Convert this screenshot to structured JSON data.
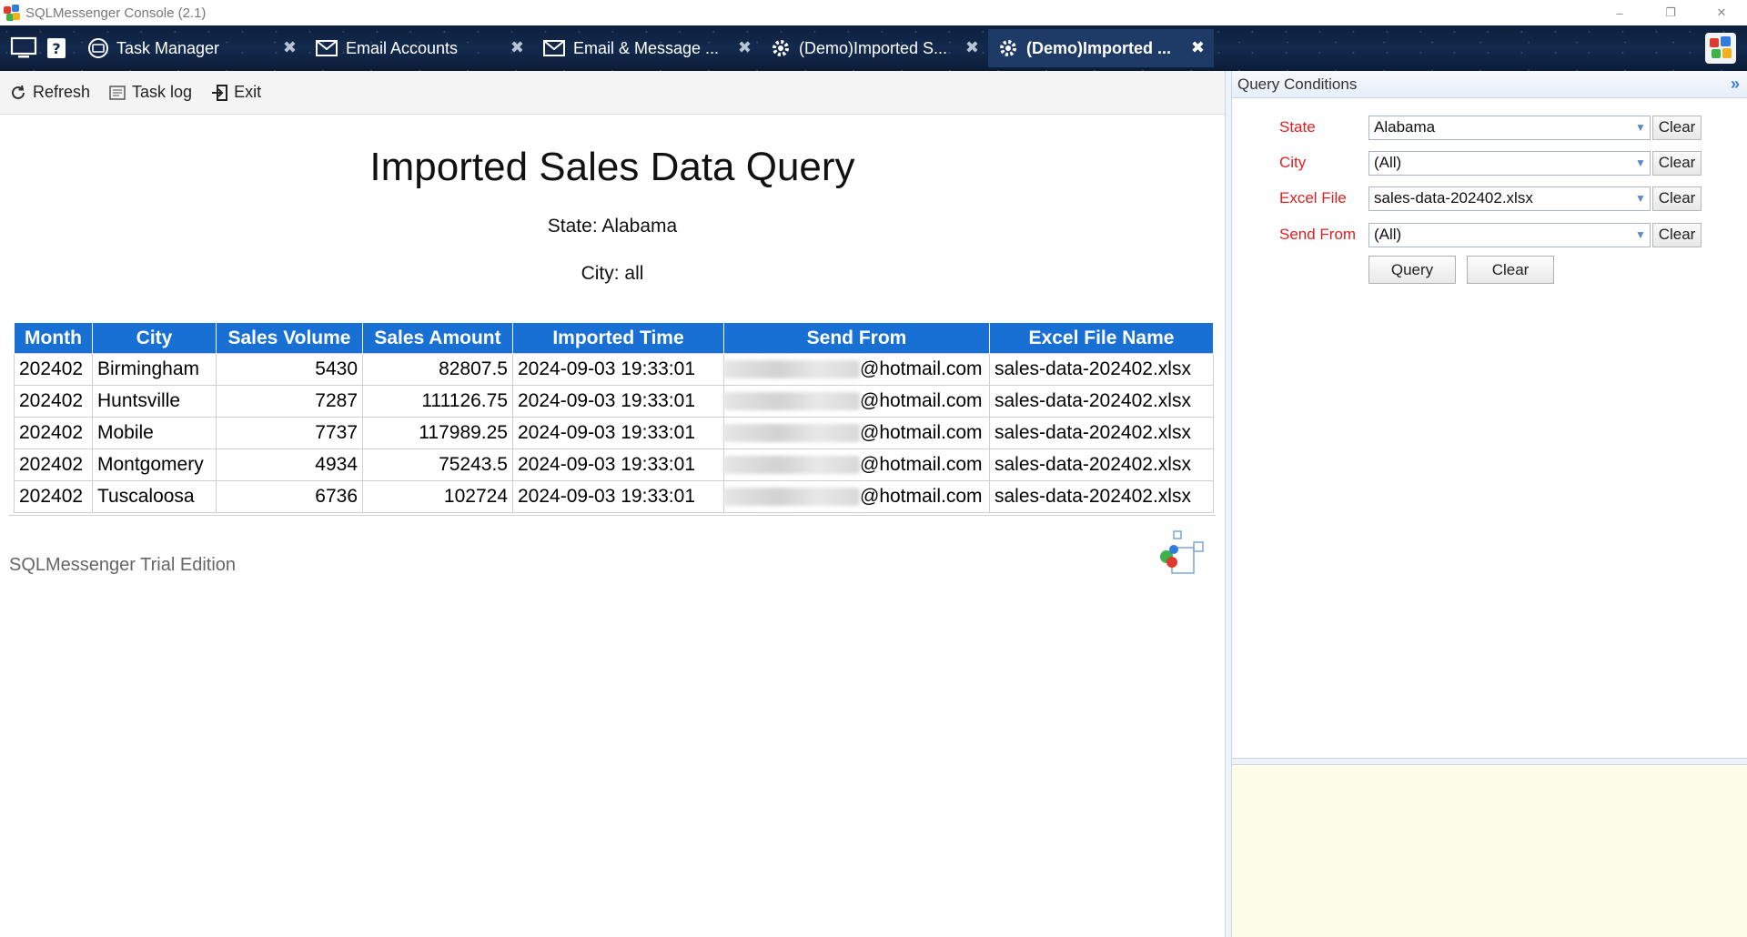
{
  "window": {
    "title": "SQLMessenger Console (2.1)",
    "controls": {
      "minimize": "–",
      "restore": "❐",
      "close": "✕"
    }
  },
  "tabs": [
    {
      "label": "Task Manager",
      "icon": "task-manager-icon"
    },
    {
      "label": "Email Accounts",
      "icon": "email-accounts-icon"
    },
    {
      "label": "Email & Message ...",
      "icon": "email-message-icon"
    },
    {
      "label": "(Demo)Imported S...",
      "icon": "gear-icon"
    },
    {
      "label": "(Demo)Imported ...",
      "icon": "gear-icon",
      "active": true
    }
  ],
  "toolbar": {
    "refresh_label": "Refresh",
    "tasklog_label": "Task log",
    "exit_label": "Exit"
  },
  "report": {
    "title": "Imported Sales Data Query",
    "state_line": "State: Alabama",
    "city_line": "City: all",
    "columns": [
      "Month",
      "City",
      "Sales Volume",
      "Sales Amount",
      "Imported Time",
      "Send From",
      "Excel File Name"
    ],
    "rows": [
      {
        "month": "202402",
        "city": "Birmingham",
        "volume": "5430",
        "amount": "82807.5",
        "time": "2024-09-03 19:33:01",
        "from": "@hotmail.com",
        "file": "sales-data-202402.xlsx"
      },
      {
        "month": "202402",
        "city": "Huntsville",
        "volume": "7287",
        "amount": "111126.75",
        "time": "2024-09-03 19:33:01",
        "from": "@hotmail.com",
        "file": "sales-data-202402.xlsx"
      },
      {
        "month": "202402",
        "city": "Mobile",
        "volume": "7737",
        "amount": "117989.25",
        "time": "2024-09-03 19:33:01",
        "from": "@hotmail.com",
        "file": "sales-data-202402.xlsx"
      },
      {
        "month": "202402",
        "city": "Montgomery",
        "volume": "4934",
        "amount": "75243.5",
        "time": "2024-09-03 19:33:01",
        "from": "@hotmail.com",
        "file": "sales-data-202402.xlsx"
      },
      {
        "month": "202402",
        "city": "Tuscaloosa",
        "volume": "6736",
        "amount": "102724",
        "time": "2024-09-03 19:33:01",
        "from": "@hotmail.com",
        "file": "sales-data-202402.xlsx"
      }
    ],
    "footer_text": "SQLMessenger Trial Edition"
  },
  "panel": {
    "title": "Query Conditions",
    "fields": [
      {
        "label": "State",
        "value": "Alabama",
        "clear": "Clear"
      },
      {
        "label": "City",
        "value": "(All)",
        "clear": "Clear"
      },
      {
        "label": "Excel File",
        "value": "sales-data-202402.xlsx",
        "clear": "Clear"
      },
      {
        "label": "Send From",
        "value": "(All)",
        "clear": "Clear"
      }
    ],
    "query_label": "Query",
    "clear_label": "Clear"
  },
  "colors": {
    "accent": "#1870d5",
    "label_red": "#e02020",
    "tabbar_bg": "#132a4e",
    "notes_bg": "#fdfde8"
  }
}
